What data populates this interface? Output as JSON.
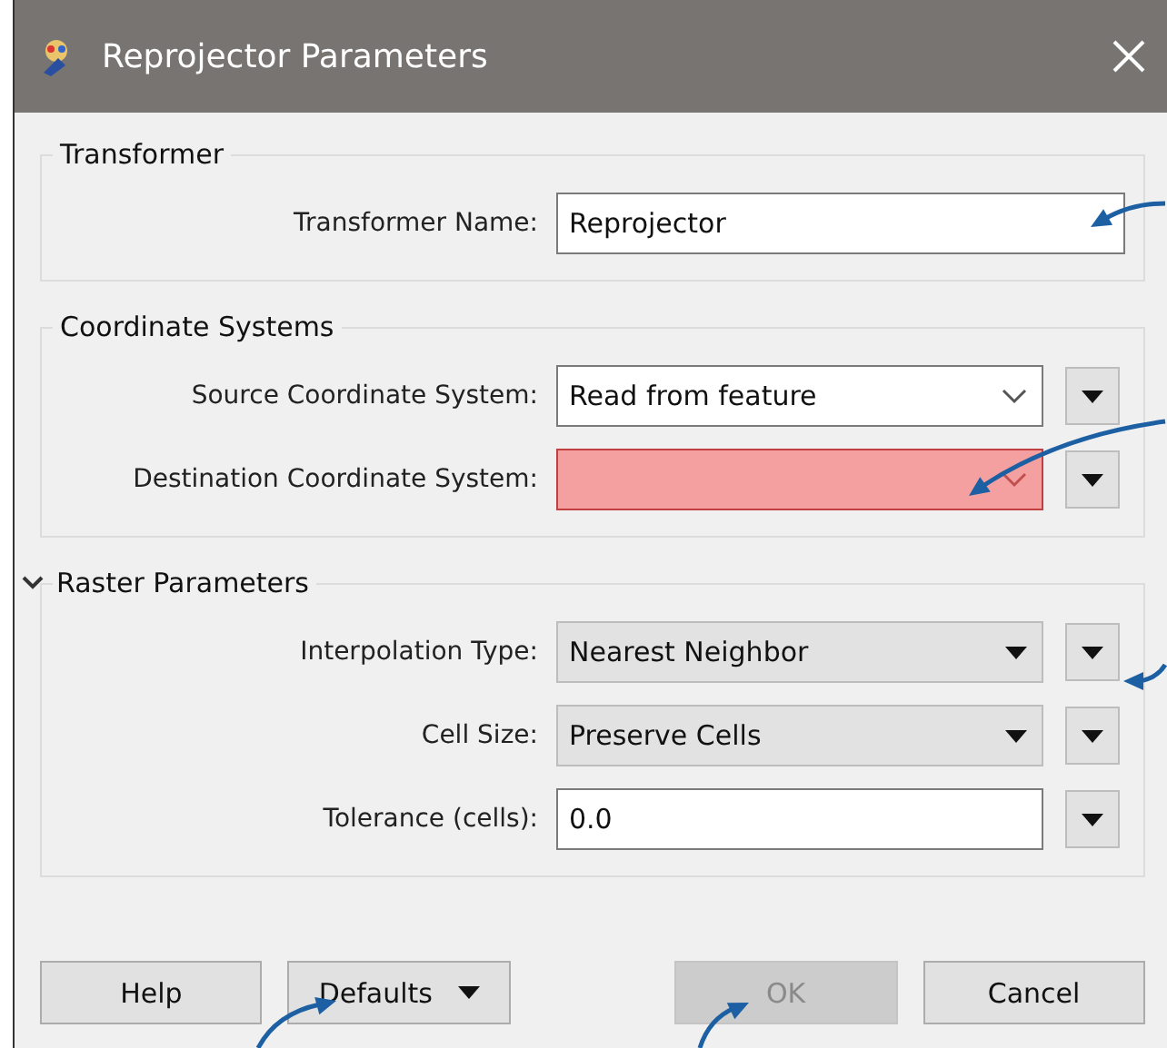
{
  "window": {
    "title": "Reprojector Parameters"
  },
  "groups": [
    {
      "title": "Transformer",
      "rows": [
        {
          "label": "Transformer Name:",
          "kind": "text",
          "value": "Reprojector",
          "menu_button": false
        }
      ]
    },
    {
      "title": "Coordinate Systems",
      "rows": [
        {
          "label": "Source Coordinate System:",
          "kind": "combo",
          "value": "Read from feature",
          "menu_button": true
        },
        {
          "label": "Destination Coordinate System:",
          "kind": "error",
          "menu_button": true
        }
      ]
    },
    {
      "title": "Raster Parameters",
      "expanded": true,
      "rows": [
        {
          "label": "Interpolation Type:",
          "kind": "dropdown",
          "value": "Nearest Neighbor",
          "menu_button": true
        },
        {
          "label": "Cell Size:",
          "kind": "dropdown",
          "value": "Preserve Cells",
          "menu_button": true
        },
        {
          "label": "Tolerance (cells):",
          "kind": "text",
          "value": "0.0",
          "menu_button": true
        }
      ]
    }
  ],
  "buttons": [
    {
      "label": "Help",
      "kind": "plain",
      "disabled": false
    },
    {
      "label": "Defaults",
      "kind": "split",
      "disabled": false
    },
    {
      "label": "OK",
      "kind": "plain",
      "disabled": true
    },
    {
      "label": "Cancel",
      "kind": "plain",
      "disabled": false
    }
  ]
}
